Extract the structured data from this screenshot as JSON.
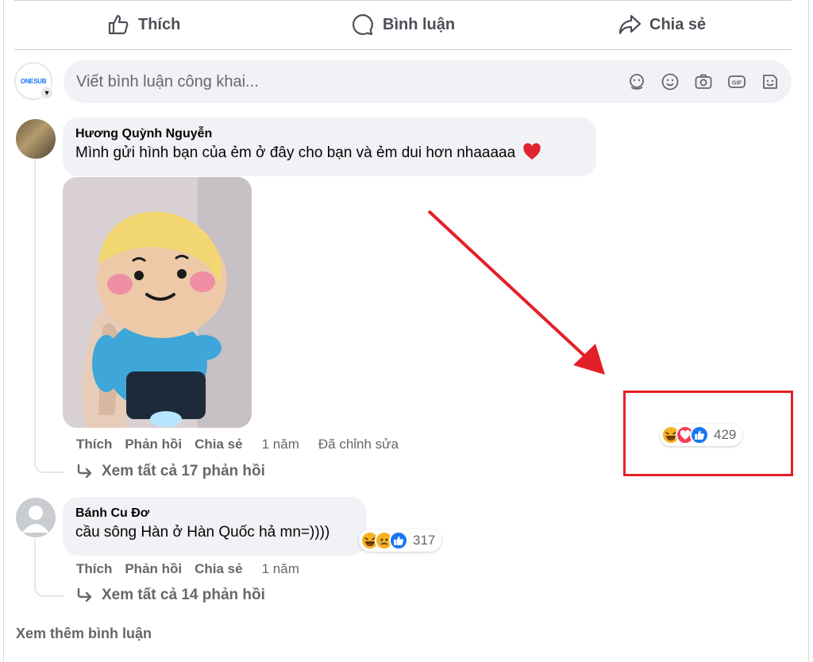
{
  "actions": {
    "like": "Thích",
    "comment": "Bình luận",
    "share": "Chia sẻ"
  },
  "composer": {
    "avatar_text": "ONESUB",
    "placeholder": "Viết bình luận công khai..."
  },
  "comments": [
    {
      "author": "Hương Quỳnh Nguyễn",
      "text": "Mình gửi hình bạn của ẻm ở đây cho bạn và ẻm dui hơn nhaaaaa",
      "like": "Thích",
      "reply": "Phản hồi",
      "share": "Chia sẻ",
      "time": "1 năm",
      "edited": "Đã chỉnh sửa",
      "reaction_count": "429",
      "view_replies": "Xem tất cả 17 phản hồi"
    },
    {
      "author": "Bánh Cu Đơ",
      "text": "cầu sông Hàn ở Hàn Quốc hả mn=))))",
      "like": "Thích",
      "reply": "Phản hồi",
      "share": "Chia sẻ",
      "time": "1 năm",
      "reaction_count": "317",
      "view_replies": "Xem tất cả 14 phản hồi"
    }
  ],
  "more_comments": "Xem thêm bình luận",
  "colors": {
    "annotation": "#e32027",
    "like_blue": "#1877f2",
    "love_red": "#f33e58",
    "haha_yellow": "#f7b125"
  }
}
